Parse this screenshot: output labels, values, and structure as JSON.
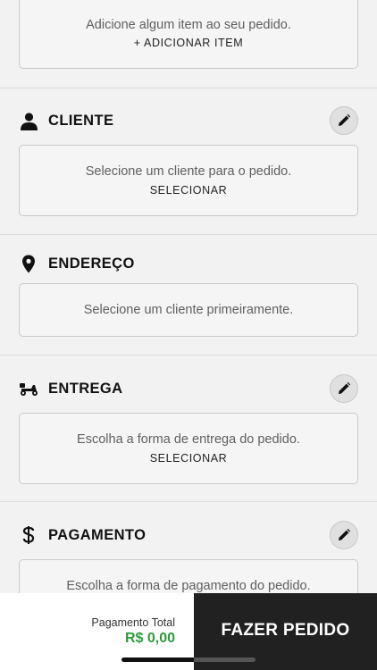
{
  "items": {
    "message": "Adicione algum item ao seu pedido.",
    "action": "+ ADICIONAR ITEM"
  },
  "cliente": {
    "title": "CLIENTE",
    "message": "Selecione um cliente para o pedido.",
    "action": "SELECIONAR",
    "icon": "person-icon"
  },
  "endereco": {
    "title": "ENDEREÇO",
    "message": "Selecione um cliente primeiramente.",
    "icon": "location-pin-icon"
  },
  "entrega": {
    "title": "ENTREGA",
    "message": "Escolha a forma de entrega do pedido.",
    "action": "SELECIONAR",
    "icon": "scooter-icon"
  },
  "pagamento": {
    "title": "PAGAMENTO",
    "message": "Escolha a forma de pagamento do pedido.",
    "icon": "dollar-icon"
  },
  "footer": {
    "total_label": "Pagamento Total",
    "total_value": "R$ 0,00",
    "order_button": "FAZER PEDIDO"
  },
  "colors": {
    "accent_green": "#2e9a3c",
    "dark_button": "#212121"
  }
}
